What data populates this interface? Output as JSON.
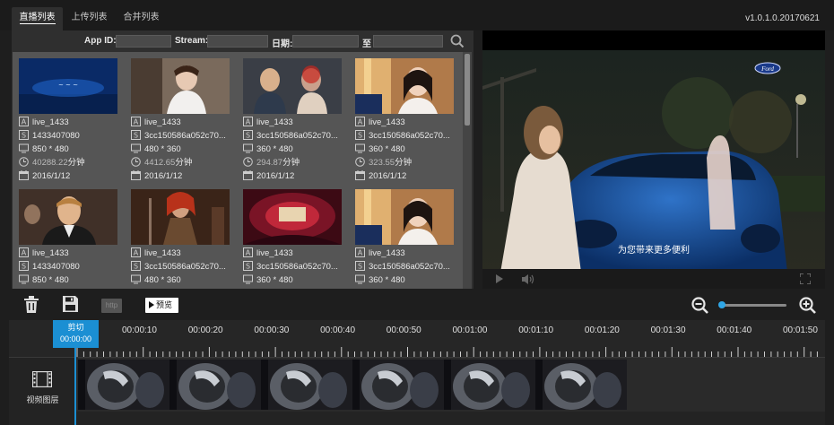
{
  "tabs": [
    {
      "label": "直播列表",
      "active": true
    },
    {
      "label": "上传列表",
      "active": false
    },
    {
      "label": "合并列表",
      "active": false
    }
  ],
  "version": "v1.0.1.0.20170621",
  "filter": {
    "app_id_label": "App ID:",
    "stream_label": "Stream:",
    "date_label": "日期:",
    "to_label": "至",
    "app_id_value": "",
    "stream_value": "",
    "date_from_value": "",
    "date_to_value": ""
  },
  "cards": [
    {
      "name": "live_1433",
      "stream": "1433407080",
      "resolution": "850 * 480",
      "duration_num": "40288.22",
      "duration_unit": "分钟",
      "date": "2016/1/12",
      "thumb": "blue-logo"
    },
    {
      "name": "live_1433",
      "stream": "3cc150586a052c70...",
      "resolution": "480 * 360",
      "duration_num": "4412.65",
      "duration_unit": "分钟",
      "date": "2016/1/12",
      "thumb": "bride"
    },
    {
      "name": "live_1433",
      "stream": "3cc150586a052c70...",
      "resolution": "360 * 480",
      "duration_num": "294.87",
      "duration_unit": "分钟",
      "date": "2016/1/12",
      "thumb": "couple"
    },
    {
      "name": "live_1433",
      "stream": "3cc150586a052c70...",
      "resolution": "360 * 480",
      "duration_num": "323.55",
      "duration_unit": "分钟",
      "date": "2016/1/12",
      "thumb": "woman"
    },
    {
      "name": "live_1433",
      "stream": "1433407080",
      "resolution": "850 * 480",
      "duration_num": "",
      "duration_unit": "",
      "date": "",
      "thumb": "man-suit"
    },
    {
      "name": "live_1433",
      "stream": "3cc150586a052c70...",
      "resolution": "480 * 360",
      "duration_num": "",
      "duration_unit": "",
      "date": "",
      "thumb": "warrior"
    },
    {
      "name": "live_1433",
      "stream": "3cc150586a052c70...",
      "resolution": "360 * 480",
      "duration_num": "",
      "duration_unit": "",
      "date": "",
      "thumb": "theater"
    },
    {
      "name": "live_1433",
      "stream": "3cc150586a052c70...",
      "resolution": "360 * 480",
      "duration_num": "",
      "duration_unit": "",
      "date": "",
      "thumb": "woman"
    }
  ],
  "player": {
    "subtitle": "为您带来更多便利",
    "logo_text": "Ford"
  },
  "toolbar": {
    "http_label": "http",
    "preview_label": "预览",
    "zoom_level": 0.02
  },
  "timeline": {
    "cut_label": "剪切",
    "cut_time": "00:00:00",
    "ticks": [
      "00:00:10",
      "00:00:20",
      "00:00:30",
      "00:00:40",
      "00:00:50",
      "00:01:00",
      "00:01:10",
      "00:01:20",
      "00:01:30",
      "00:01:40",
      "00:01:50"
    ],
    "layer_label": "视频图层",
    "clip_count": 6
  },
  "colors": {
    "accent": "#1b8fd3",
    "panel": "#2f2f2f",
    "grid_bg": "#555555"
  }
}
